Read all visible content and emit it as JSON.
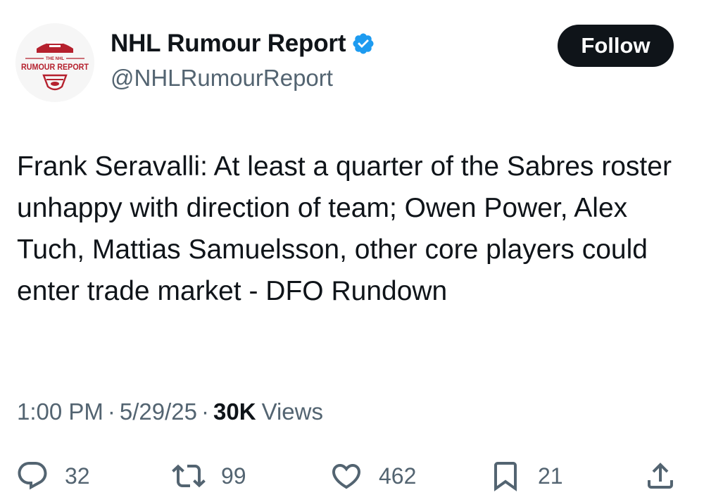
{
  "account": {
    "display_name": "NHL Rumour Report",
    "handle": "@NHLRumourReport",
    "verified": true,
    "avatar_text_top": "THE NHL",
    "avatar_text_main": "RUMOUR REPORT"
  },
  "follow_label": "Follow",
  "tweet": {
    "text": "Frank Seravalli: At least a quarter of the Sabres roster unhappy with direction of team; Owen Power, Alex Tuch, Mattias Samuelsson, other core players could enter trade market - DFO Rundown"
  },
  "meta": {
    "time": "1:00 PM",
    "separator": "·",
    "date": "5/29/25",
    "views_count": "30K",
    "views_label": "Views"
  },
  "actions": {
    "replies": "32",
    "reposts": "99",
    "likes": "462",
    "bookmarks": "21"
  },
  "icons": [
    "reply-icon",
    "repost-icon",
    "like-icon",
    "bookmark-icon",
    "share-icon",
    "verified-badge-icon"
  ],
  "colors": {
    "text": "#0f1419",
    "secondary": "#536471",
    "verified": "#1d9bf0",
    "follow_bg": "#0f1419",
    "logo_red": "#b5212e"
  }
}
